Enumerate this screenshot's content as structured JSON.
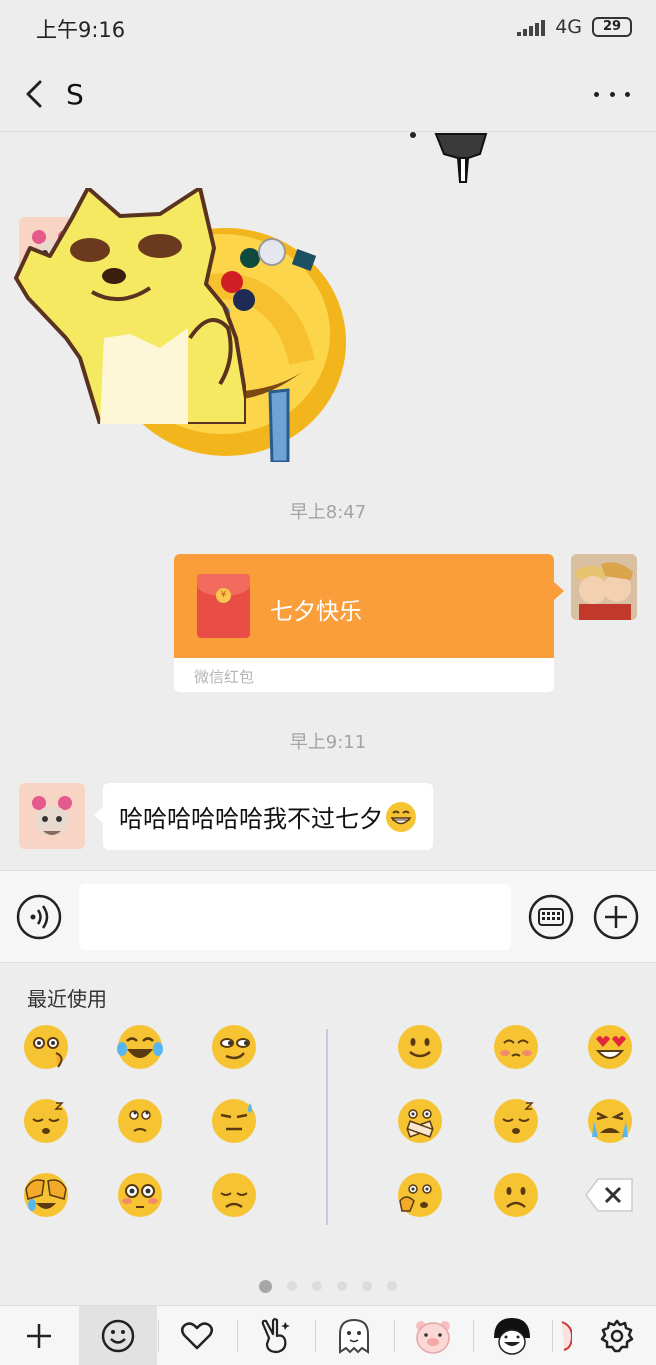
{
  "status_bar": {
    "time": "上午9:16",
    "network": "4G",
    "battery": "29"
  },
  "header": {
    "title": "S"
  },
  "chat": {
    "messages": [
      {
        "type": "timestamp",
        "text": "早上8:47"
      },
      {
        "type": "red_packet",
        "sender": "me",
        "title": "七夕快乐",
        "label": "微信红包"
      },
      {
        "type": "timestamp",
        "text": "早上9:11"
      },
      {
        "type": "text",
        "sender": "other",
        "text": "哈哈哈哈哈哈我不过七夕"
      }
    ]
  },
  "input": {
    "value": "",
    "placeholder": ""
  },
  "emoji_panel": {
    "section_title": "最近使用",
    "pages": 6,
    "active_page": 1
  },
  "colors": {
    "red_packet": "#fa9d3b",
    "background": "#ededed"
  }
}
